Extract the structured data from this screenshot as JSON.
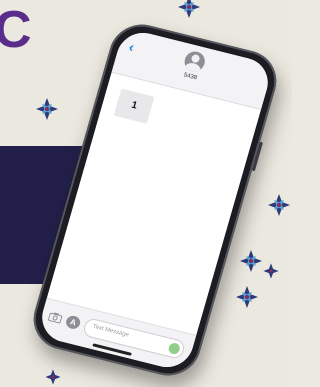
{
  "brand": {
    "letter": "C",
    "color": "#5a2d8c"
  },
  "background": {
    "base_color": "#ebe8df",
    "panel_color": "#22204a",
    "ornament_icon": "star-ornament-icon",
    "ornament_colors": [
      "#2b3a7a",
      "#4fa3d9",
      "#8a2b5a"
    ]
  },
  "phone": {
    "frame_color": "#1c1c22",
    "header": {
      "back_icon": "chevron-left-icon",
      "back_glyph": "‹",
      "avatar_icon": "person-avatar-icon",
      "contact_number": "5438"
    },
    "messages": [
      {
        "text": "1"
      }
    ],
    "input_bar": {
      "camera_icon": "camera-icon",
      "apps_icon": "app-store-icon",
      "apps_glyph": "A",
      "placeholder": "Text Message",
      "mic_icon": "audio-record-icon",
      "accent_color": "#8fcf8a"
    }
  }
}
